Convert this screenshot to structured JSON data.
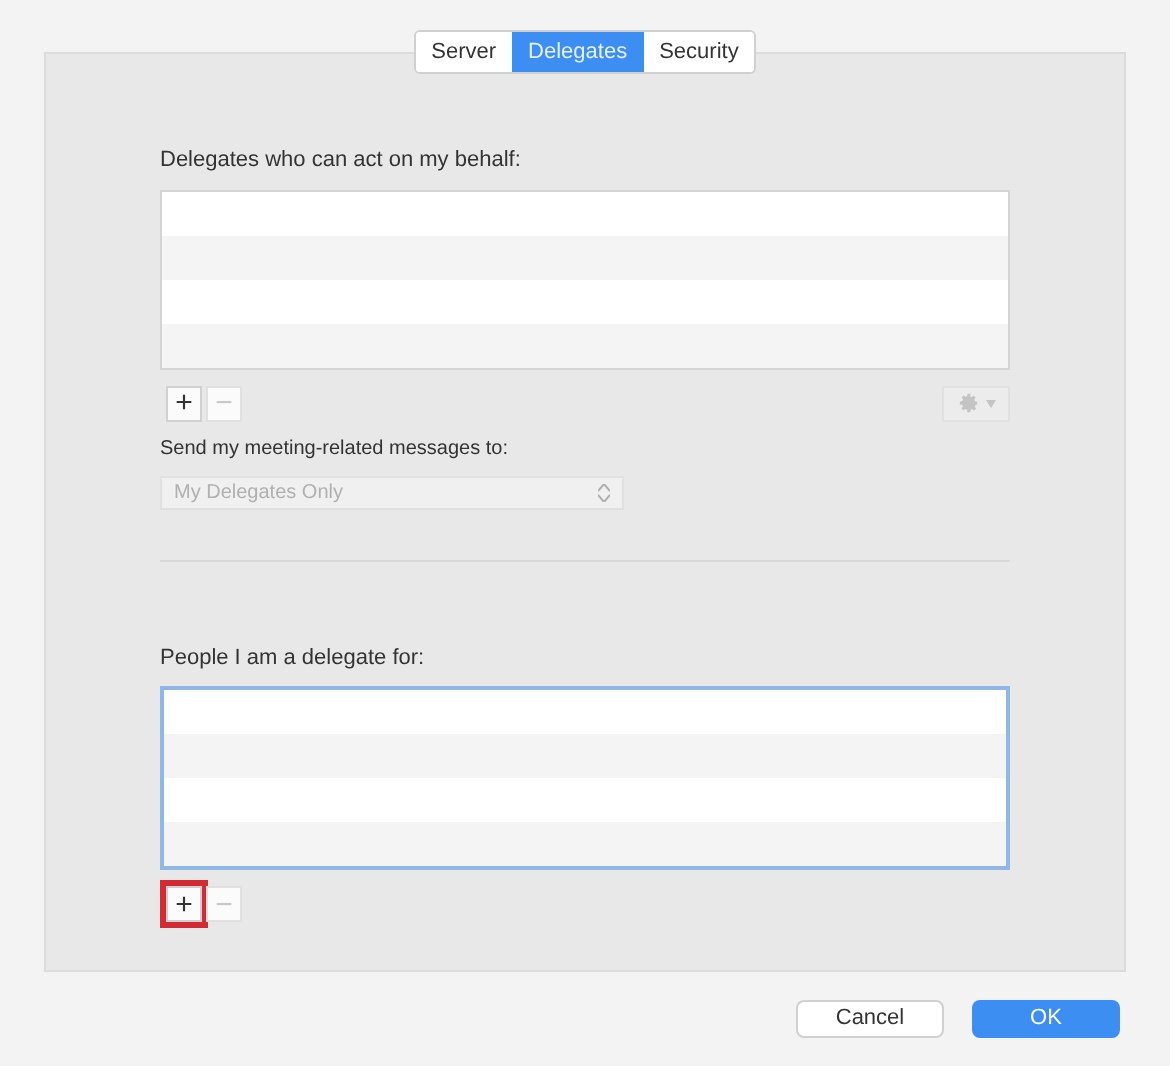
{
  "tabs": [
    {
      "label": "Server",
      "selected": false
    },
    {
      "label": "Delegates",
      "selected": true
    },
    {
      "label": "Security",
      "selected": false
    }
  ],
  "delegates_section": {
    "label": "Delegates who can act on my behalf:",
    "add_button": {
      "label": "+",
      "disabled": false,
      "highlighted": false
    },
    "remove_button": {
      "label": "−",
      "disabled": true,
      "highlighted": false
    },
    "focused": false
  },
  "send_messages": {
    "label": "Send my meeting-related messages to:",
    "value": "My Delegates Only",
    "disabled": true
  },
  "delegate_for_section": {
    "label": "People I am a delegate for:",
    "add_button": {
      "label": "+",
      "disabled": false,
      "highlighted": true
    },
    "remove_button": {
      "label": "−",
      "disabled": true,
      "highlighted": false
    },
    "focused": true
  },
  "buttons": [
    {
      "label": "Cancel",
      "kind": "secondary"
    },
    {
      "label": "OK",
      "kind": "primary"
    }
  ]
}
